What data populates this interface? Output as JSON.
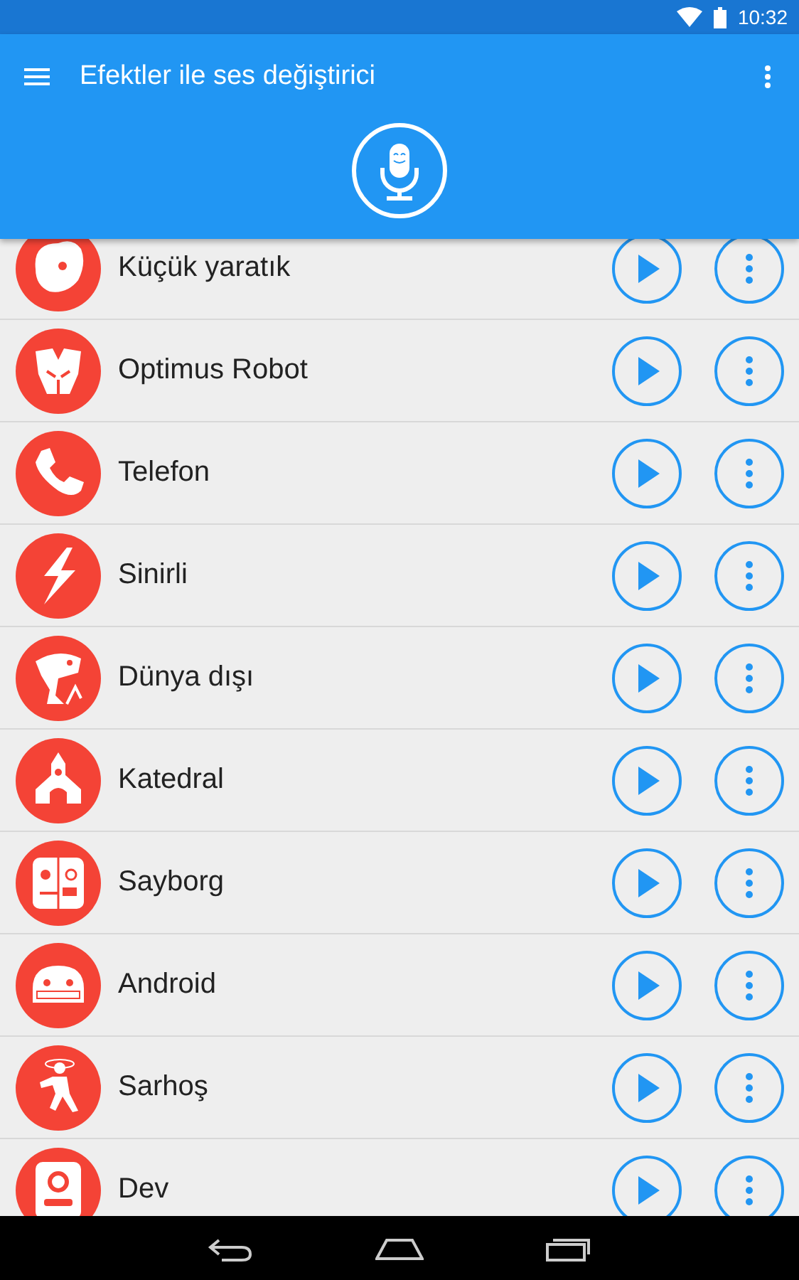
{
  "status_bar": {
    "time": "10:32"
  },
  "app_bar": {
    "title": "Efektler ile ses değiştirici"
  },
  "effects": [
    {
      "name": "Küçük yaratık",
      "kind": "creature"
    },
    {
      "name": "Optimus Robot",
      "kind": "robot"
    },
    {
      "name": "Telefon",
      "kind": "phone"
    },
    {
      "name": "Sinirli",
      "kind": "bolt"
    },
    {
      "name": "Dünya dışı",
      "kind": "alien"
    },
    {
      "name": "Katedral",
      "kind": "church"
    },
    {
      "name": "Sayborg",
      "kind": "cyborg"
    },
    {
      "name": "Android",
      "kind": "android"
    },
    {
      "name": "Sarhoş",
      "kind": "drunk"
    },
    {
      "name": "Dev",
      "kind": "giant"
    }
  ]
}
